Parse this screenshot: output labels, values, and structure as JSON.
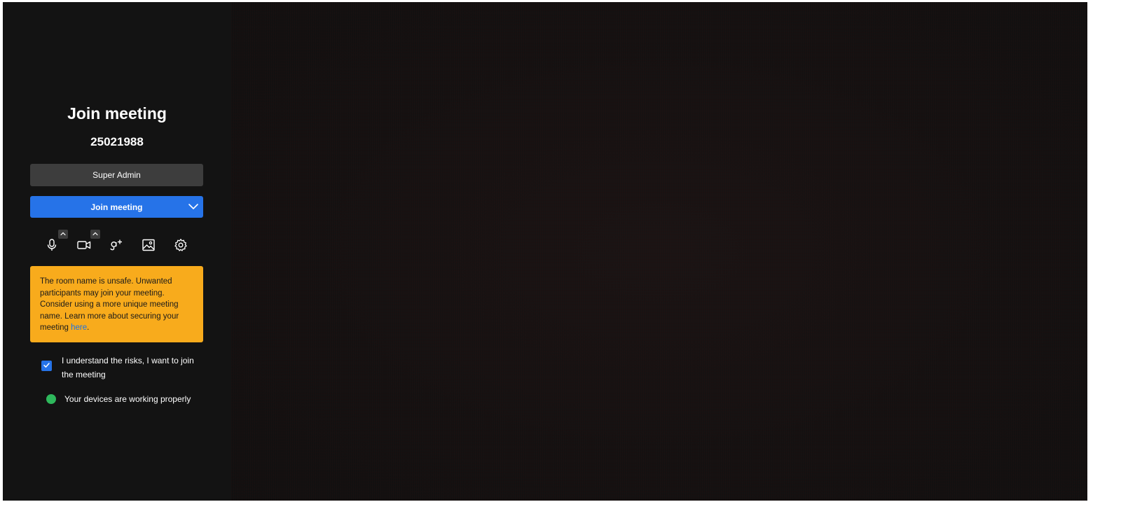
{
  "prejoin": {
    "title": "Join meeting",
    "room_id": "25021988",
    "display_name": "Super Admin",
    "join_label": "Join meeting",
    "warning": {
      "text": "The room name is unsafe. Unwanted participants may join your meeting. Consider using a more unique meeting name. Learn more about securing your meeting ",
      "link_text": "here",
      "suffix": "."
    },
    "consent": {
      "label": "I understand the risks, I want to join the meeting",
      "checked": true
    },
    "device_status": "Your devices are working properly"
  },
  "toolbar": {
    "icons": [
      "microphone-icon",
      "camera-icon",
      "invite-user-icon",
      "background-image-icon",
      "settings-gear-icon"
    ]
  },
  "colors": {
    "panel": "#131313",
    "accent": "#2673e8",
    "warning": "#f8ab1c",
    "status_ok": "#2eb85c",
    "link": "#1a73e8"
  }
}
